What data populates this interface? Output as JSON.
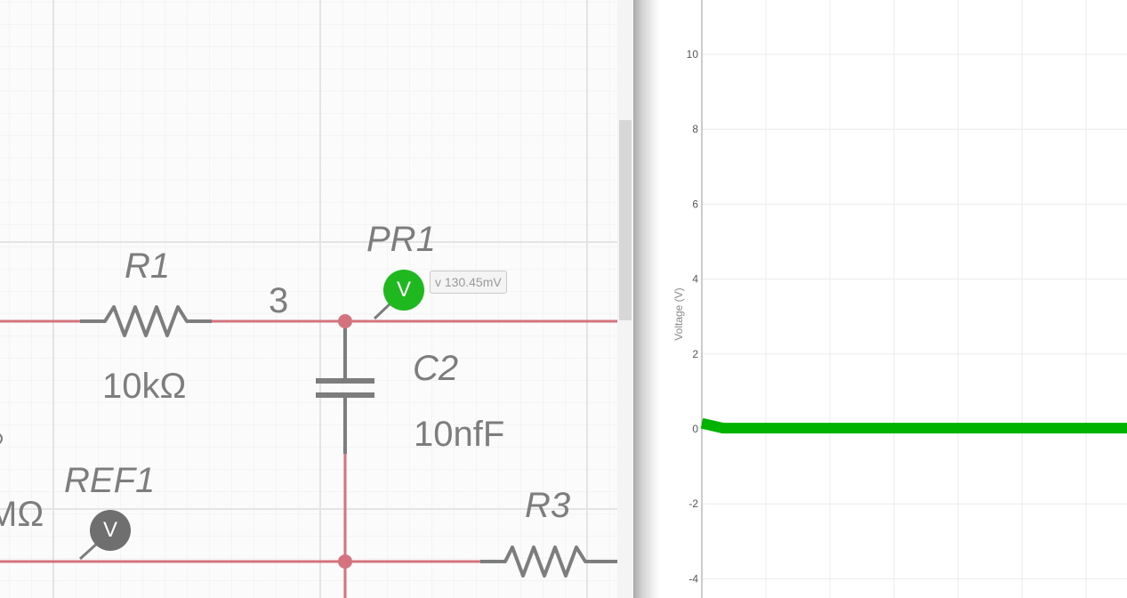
{
  "schematic": {
    "components": [
      {
        "id": "R1",
        "label": "R1",
        "value": "10kΩ"
      },
      {
        "id": "C2",
        "label": "C2",
        "value": "10nfF"
      },
      {
        "id": "R3",
        "label": "R3"
      },
      {
        "id": "PR1",
        "label": "PR1"
      },
      {
        "id": "REF1",
        "label": "REF1"
      }
    ],
    "net_label": "3",
    "partial_value": "MΩ",
    "probe_pr1": {
      "icon": "voltage-probe-icon",
      "glyph": "V",
      "color": "#1fb91f",
      "readout": "v 130.45mV"
    },
    "probe_ref1": {
      "icon": "voltage-probe-icon",
      "glyph": "V",
      "color": "#6f6f6f"
    },
    "wire_color": "#d4737d",
    "component_color": "#7d7d7d"
  },
  "chart_data": {
    "type": "line",
    "ylabel": "Voltage (V)",
    "xlabel": "",
    "yticks": [
      10,
      8,
      6,
      4,
      2,
      0,
      -2,
      -4
    ],
    "ylim": [
      -4.4,
      11.5
    ],
    "grid": true,
    "series": [
      {
        "color": "#00b300",
        "x": [
          0,
          0.05,
          1
        ],
        "y": [
          0.15,
          0.02,
          0.02
        ]
      }
    ]
  }
}
